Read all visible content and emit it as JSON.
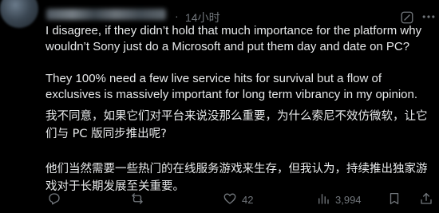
{
  "header": {
    "separator": "·",
    "time": "14小时"
  },
  "body": {
    "p1": "I disagree, if they didn’t hold that much importance for the platform why wouldn’t Sony just do a Microsoft and put them day and date on PC?",
    "p2": "They 100% need a few live service hits for survival but a flow of exclusives is massively important for long term vibrancy in my opinion.",
    "p3": "我不同意，如果它们对平台来说没那么重要，为什么索尼不效仿微软，让它们与 PC 版同步推出呢?",
    "p4": "他们当然需要一些热门的在线服务游戏来生存，但我认为，持续推出独家游戏对于长期发展至关重要。"
  },
  "actions": {
    "like_count": "42",
    "view_count": "3,994"
  },
  "icons": {
    "reply": "reply-icon",
    "retweet": "retweet-icon",
    "like": "heart-icon",
    "views": "analytics-icon",
    "bookmark": "bookmark-icon",
    "share": "share-icon",
    "grok": "grok-icon",
    "more": "more-icon"
  },
  "colors": {
    "background": "#000000",
    "text": "#e7e9ea",
    "muted": "#71767b"
  }
}
